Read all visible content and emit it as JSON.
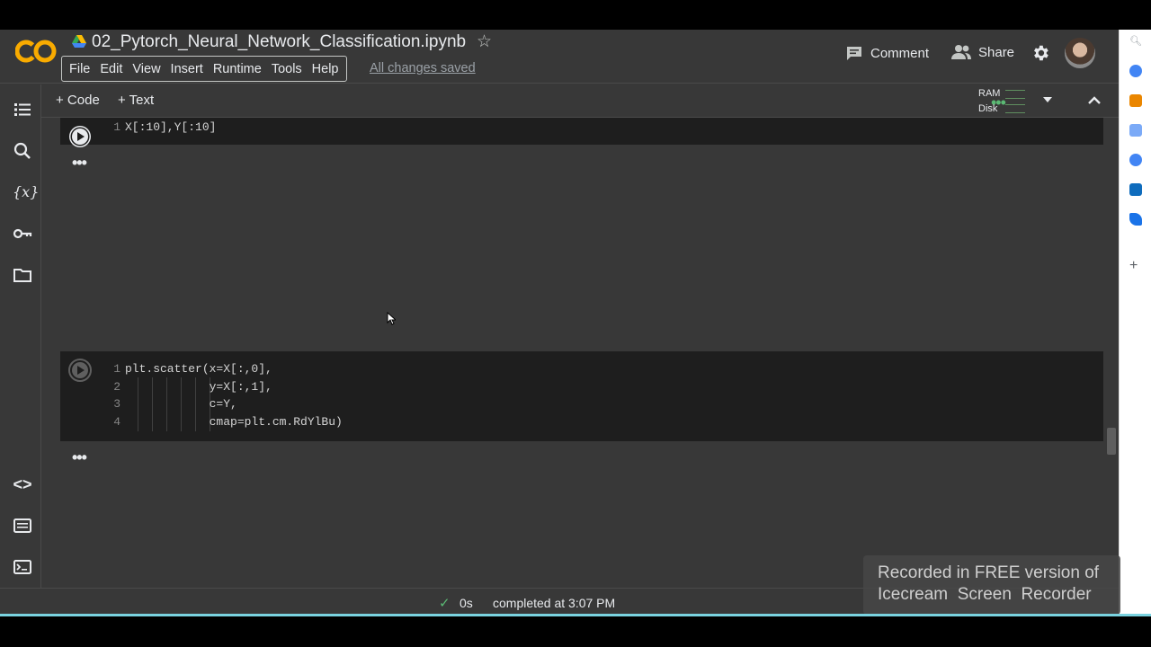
{
  "app": {
    "title": "02_Pytorch_Neural_Network_Classification.ipynb",
    "saved_status": "All changes saved"
  },
  "menu": [
    "File",
    "Edit",
    "View",
    "Insert",
    "Runtime",
    "Tools",
    "Help"
  ],
  "header_actions": {
    "comment": "Comment",
    "share": "Share"
  },
  "toolbar": {
    "add_code": "+ Code",
    "add_text": "+ Text",
    "ram_label": "RAM",
    "disk_label": "Disk"
  },
  "cells": [
    {
      "lines": [
        {
          "num": "1",
          "code": "X[:10],Y[:10]"
        }
      ],
      "output_menu": "•••"
    },
    {
      "lines": [
        {
          "num": "1",
          "code": "plt.scatter(x=X[:,0],"
        },
        {
          "num": "2",
          "code": "            y=X[:,1],"
        },
        {
          "num": "3",
          "code": "            c=Y,"
        },
        {
          "num": "4",
          "code": "            cmap=plt.cm.RdYlBu)"
        }
      ],
      "output_menu": "•••"
    }
  ],
  "status": {
    "check": "✓",
    "duration": "0s",
    "completed": "completed at 3:07 PM"
  },
  "watermark": {
    "line1": "Recorded in FREE version of",
    "line2": "Icecream  Screen  Recorder"
  },
  "colors": {
    "background": "#383838",
    "cell_bg": "#1e1e1e",
    "accent_green": "#5bb974",
    "colab_orange": "#f9ab00"
  }
}
